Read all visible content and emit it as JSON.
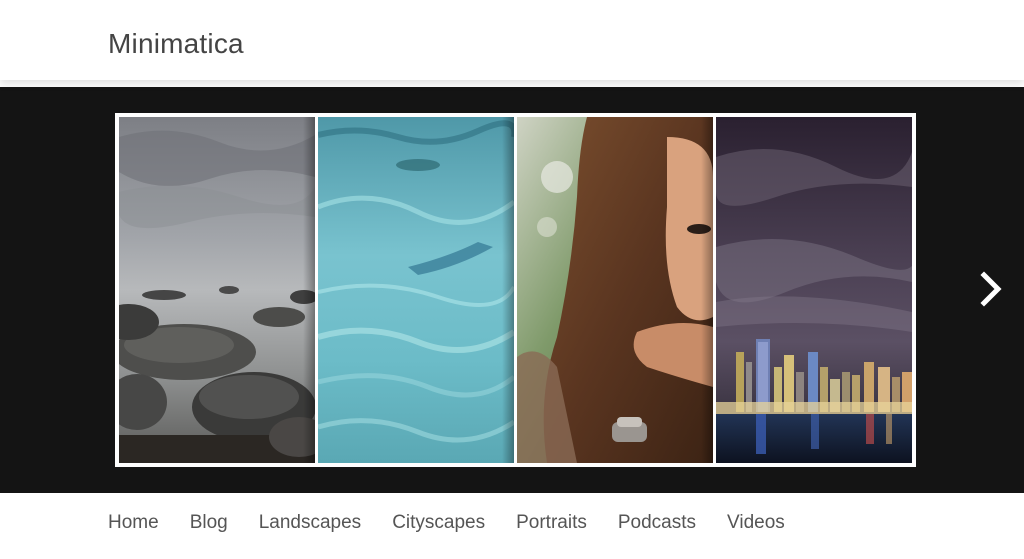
{
  "header": {
    "site_title": "Minimatica"
  },
  "slider": {
    "slides": [
      {
        "subject": "foggy rocky seashore"
      },
      {
        "subject": "turquoise water surface"
      },
      {
        "subject": "portrait of woman with long hair"
      },
      {
        "subject": "city skyline at night"
      }
    ],
    "next_icon": "chevron-right-icon"
  },
  "nav": {
    "items": [
      {
        "label": "Home"
      },
      {
        "label": "Blog"
      },
      {
        "label": "Landscapes"
      },
      {
        "label": "Cityscapes"
      },
      {
        "label": "Portraits"
      },
      {
        "label": "Podcasts"
      },
      {
        "label": "Videos"
      }
    ]
  },
  "colors": {
    "slider_background": "#141414",
    "frame": "#ffffff",
    "title_text": "#444444",
    "nav_text": "#555555"
  }
}
